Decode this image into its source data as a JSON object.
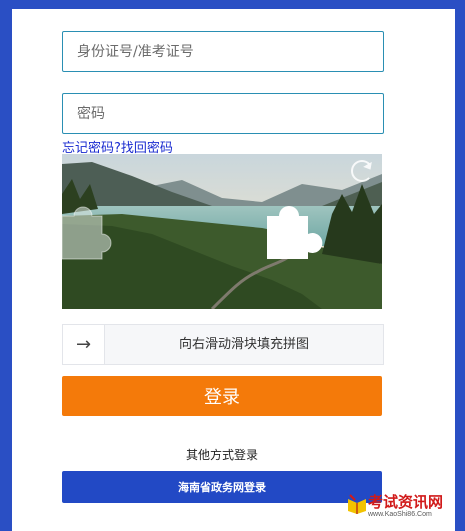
{
  "form": {
    "id_placeholder": "身份证号/准考证号",
    "password_placeholder": "密码",
    "forgot_link": "忘记密码?找回密码"
  },
  "captcha": {
    "slider_text": "向右滑动滑块填充拼图",
    "slider_icon": "→"
  },
  "actions": {
    "login_label": "登录",
    "other_methods": "其他方式登录",
    "gov_login_label": "海南省政务网登录"
  },
  "watermark": {
    "title": "考试资讯网",
    "url": "www.KaoShi86.Com"
  },
  "colors": {
    "background": "#2a4fc4",
    "accent_orange": "#f47a0a",
    "gov_blue": "#2249c5",
    "link_blue": "#1a2bd0",
    "input_border": "#2a8fb3"
  }
}
